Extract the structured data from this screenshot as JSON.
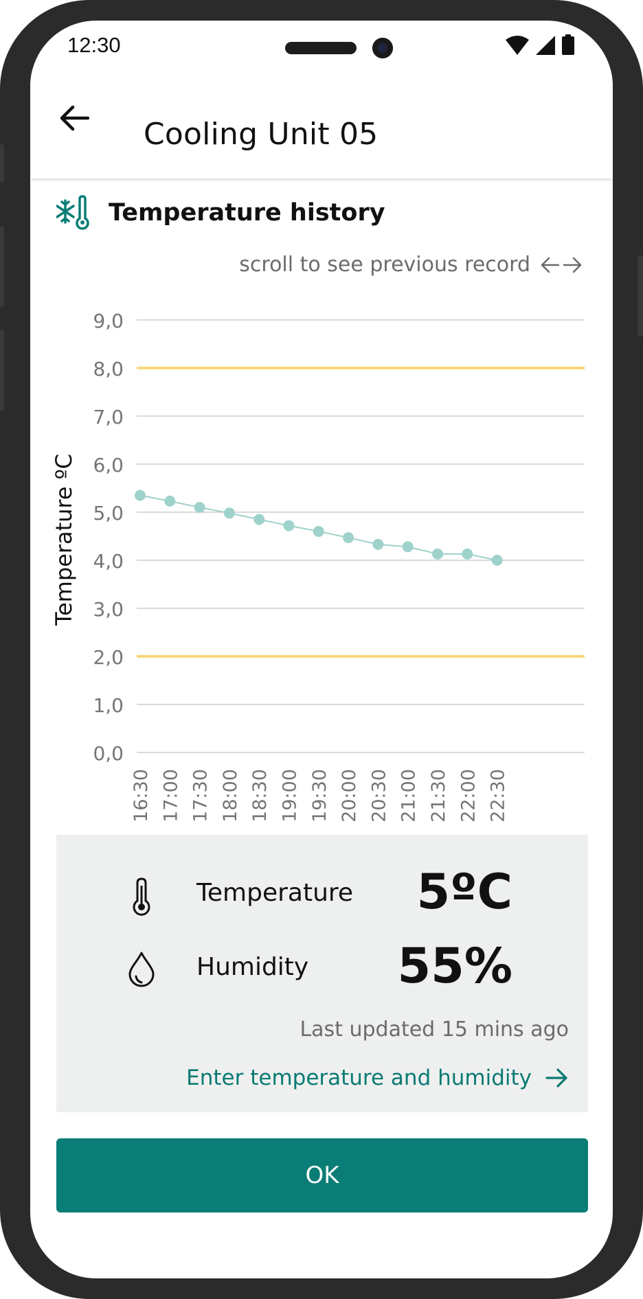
{
  "status_bar": {
    "time": "12:30"
  },
  "app_bar": {
    "title": "Cooling Unit 05",
    "back_icon": "arrow-left-icon"
  },
  "section": {
    "title": "Temperature history",
    "icon": "snowflake-thermometer-icon",
    "scroll_hint": "scroll to see previous record"
  },
  "chart_data": {
    "type": "line",
    "ylabel": "Temperature ºC",
    "ylim": [
      0,
      9
    ],
    "y_ticks": [
      "0,0",
      "1,0",
      "2,0",
      "3,0",
      "4,0",
      "5,0",
      "6,0",
      "7,0",
      "8,0",
      "9,0"
    ],
    "x": [
      "16:30",
      "17:00",
      "17:30",
      "18:00",
      "18:30",
      "19:00",
      "19:30",
      "20:00",
      "20:30",
      "21:00",
      "21:30",
      "22:00",
      "22:30"
    ],
    "series": [
      {
        "values": [
          5.35,
          5.23,
          5.1,
          4.98,
          4.85,
          4.72,
          4.6,
          4.47,
          4.33,
          4.28,
          4.13,
          4.13,
          4.0
        ]
      }
    ],
    "threshold_lines": [
      8.0,
      2.0
    ],
    "colors": {
      "series": "#9fd2cb",
      "threshold": "#f7d97a",
      "grid": "#d9d9d9"
    },
    "grid": true
  },
  "readings": {
    "temperature": {
      "label": "Temperature",
      "value": "5ºC",
      "icon": "thermometer-icon"
    },
    "humidity": {
      "label": "Humidity",
      "value": "55%",
      "icon": "droplet-icon"
    },
    "last_updated": "Last updated 15 mins ago",
    "enter_link": "Enter temperature and humidity"
  },
  "buttons": {
    "ok": "OK"
  },
  "colors": {
    "accent": "#0a7d76",
    "panel": "#eef0ef"
  }
}
